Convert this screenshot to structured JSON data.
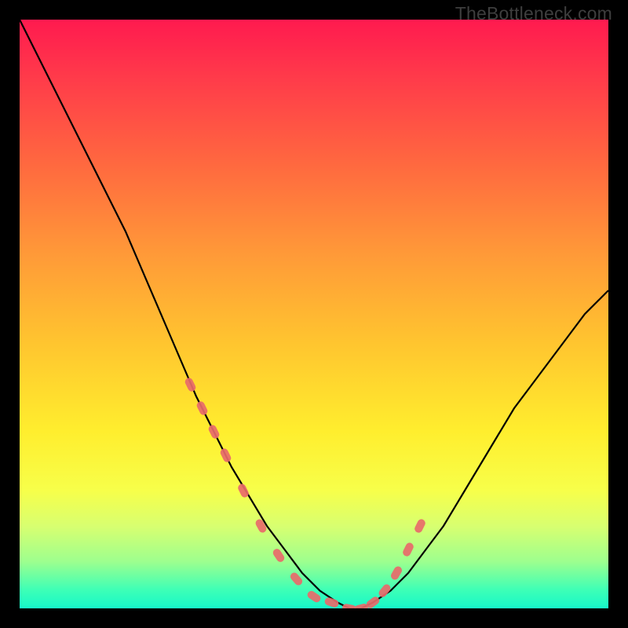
{
  "watermark": "TheBottleneck.com",
  "colors": {
    "gradient_top": "#ff1a4f",
    "gradient_mid1": "#ff9a38",
    "gradient_mid2": "#ffee2e",
    "gradient_bottom": "#17f7c9",
    "curve": "#000000",
    "marker_fill": "#e86a6a",
    "marker_stroke": "#e86a6a"
  },
  "chart_data": {
    "type": "line",
    "title": "",
    "xlabel": "",
    "ylabel": "",
    "xlim": [
      0,
      100
    ],
    "ylim": [
      0,
      100
    ],
    "series": [
      {
        "name": "bottleneck-curve",
        "x": [
          0,
          3,
          6,
          9,
          12,
          15,
          18,
          21,
          24,
          27,
          30,
          33,
          36,
          39,
          42,
          45,
          48,
          51,
          54,
          56,
          58,
          60,
          63,
          66,
          69,
          72,
          75,
          78,
          81,
          84,
          87,
          90,
          93,
          96,
          99,
          100
        ],
        "y": [
          100,
          94,
          88,
          82,
          76,
          70,
          64,
          57,
          50,
          43,
          36,
          30,
          24,
          19,
          14,
          10,
          6,
          3,
          1,
          0,
          0,
          1,
          3,
          6,
          10,
          14,
          19,
          24,
          29,
          34,
          38,
          42,
          46,
          50,
          53,
          54
        ],
        "note": "Values are percentages of the plot area; 0,0 is the bottom-left of the gradient region. Curve reaches its minimum (0) near x≈55–58 and rises again to ~54 at the right edge."
      }
    ],
    "markers": {
      "name": "highlight-dots",
      "x": [
        29,
        31,
        33,
        35,
        38,
        41,
        44,
        47,
        50,
        53,
        56,
        58,
        60,
        62,
        64,
        66,
        68
      ],
      "y": [
        38,
        34,
        30,
        26,
        20,
        14,
        9,
        5,
        2,
        1,
        0,
        0,
        1,
        3,
        6,
        10,
        14
      ],
      "note": "Salmon-colored dash-like markers clustered along the lower part of the curve."
    }
  }
}
